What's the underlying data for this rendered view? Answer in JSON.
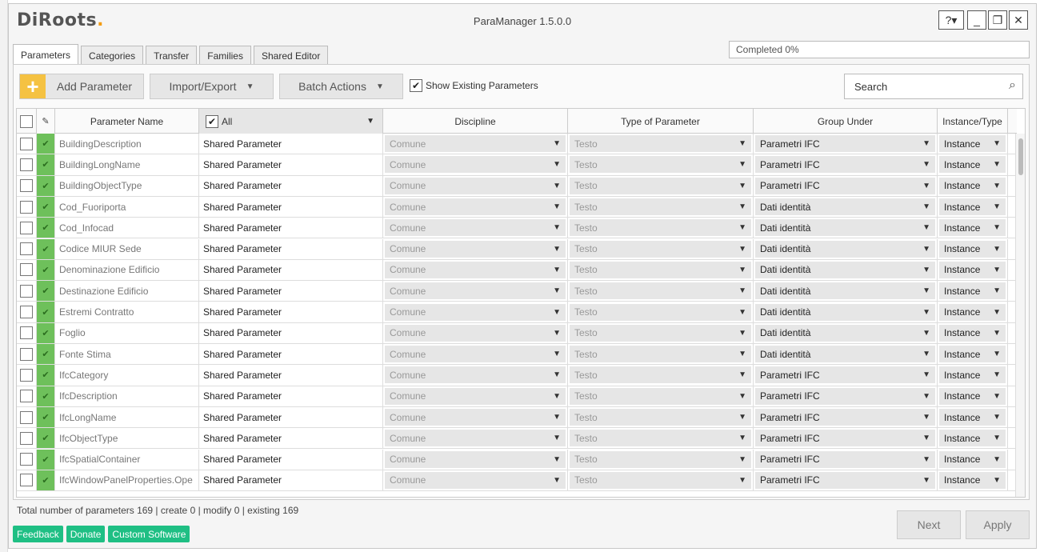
{
  "window": {
    "logo": "DiRoots",
    "logo_dot": ".",
    "title": "ParaManager 1.5.0.0",
    "help_label": "?▾",
    "min_label": "_",
    "max_label": "❐",
    "close_label": "✕"
  },
  "tabs": [
    {
      "label": "Parameters",
      "active": true
    },
    {
      "label": "Categories"
    },
    {
      "label": "Transfer"
    },
    {
      "label": "Families"
    },
    {
      "label": "Shared Editor"
    }
  ],
  "progress": {
    "text": "Completed 0%"
  },
  "toolbar": {
    "add_label": "Add Parameter",
    "import_export_label": "Import/Export",
    "batch_actions_label": "Batch Actions",
    "show_existing_label": "Show Existing Parameters",
    "show_existing_checked": true,
    "search_placeholder": "Search"
  },
  "grid": {
    "headers": {
      "name": "Parameter Name",
      "filter_all": "All",
      "discipline": "Discipline",
      "type": "Type of Parameter",
      "group": "Group Under",
      "instance": "Instance/Type"
    },
    "rows": [
      {
        "name": "BuildingDescription",
        "shared": "Shared Parameter",
        "discipline": "Comune",
        "type": "Testo",
        "group": "Parametri IFC",
        "instance": "Instance"
      },
      {
        "name": "BuildingLongName",
        "shared": "Shared Parameter",
        "discipline": "Comune",
        "type": "Testo",
        "group": "Parametri IFC",
        "instance": "Instance"
      },
      {
        "name": "BuildingObjectType",
        "shared": "Shared Parameter",
        "discipline": "Comune",
        "type": "Testo",
        "group": "Parametri IFC",
        "instance": "Instance"
      },
      {
        "name": "Cod_Fuoriporta",
        "shared": "Shared Parameter",
        "discipline": "Comune",
        "type": "Testo",
        "group": "Dati identità",
        "instance": "Instance"
      },
      {
        "name": "Cod_Infocad",
        "shared": "Shared Parameter",
        "discipline": "Comune",
        "type": "Testo",
        "group": "Dati identità",
        "instance": "Instance"
      },
      {
        "name": "Codice MIUR Sede",
        "shared": "Shared Parameter",
        "discipline": "Comune",
        "type": "Testo",
        "group": "Dati identità",
        "instance": "Instance"
      },
      {
        "name": "Denominazione Edificio",
        "shared": "Shared Parameter",
        "discipline": "Comune",
        "type": "Testo",
        "group": "Dati identità",
        "instance": "Instance"
      },
      {
        "name": "Destinazione Edificio",
        "shared": "Shared Parameter",
        "discipline": "Comune",
        "type": "Testo",
        "group": "Dati identità",
        "instance": "Instance"
      },
      {
        "name": "Estremi Contratto",
        "shared": "Shared Parameter",
        "discipline": "Comune",
        "type": "Testo",
        "group": "Dati identità",
        "instance": "Instance"
      },
      {
        "name": "Foglio",
        "shared": "Shared Parameter",
        "discipline": "Comune",
        "type": "Testo",
        "group": "Dati identità",
        "instance": "Instance"
      },
      {
        "name": "Fonte Stima",
        "shared": "Shared Parameter",
        "discipline": "Comune",
        "type": "Testo",
        "group": "Dati identità",
        "instance": "Instance"
      },
      {
        "name": "IfcCategory",
        "shared": "Shared Parameter",
        "discipline": "Comune",
        "type": "Testo",
        "group": "Parametri IFC",
        "instance": "Instance"
      },
      {
        "name": "IfcDescription",
        "shared": "Shared Parameter",
        "discipline": "Comune",
        "type": "Testo",
        "group": "Parametri IFC",
        "instance": "Instance"
      },
      {
        "name": "IfcLongName",
        "shared": "Shared Parameter",
        "discipline": "Comune",
        "type": "Testo",
        "group": "Parametri IFC",
        "instance": "Instance"
      },
      {
        "name": "IfcObjectType",
        "shared": "Shared Parameter",
        "discipline": "Comune",
        "type": "Testo",
        "group": "Parametri IFC",
        "instance": "Instance"
      },
      {
        "name": "IfcSpatialContainer",
        "shared": "Shared Parameter",
        "discipline": "Comune",
        "type": "Testo",
        "group": "Parametri IFC",
        "instance": "Instance"
      },
      {
        "name": "IfcWindowPanelProperties.Ope",
        "shared": "Shared Parameter",
        "discipline": "Comune",
        "type": "Testo",
        "group": "Parametri IFC",
        "instance": "Instance"
      }
    ]
  },
  "footer": {
    "status": "Total number of parameters 169 | create 0 | modify 0 | existing 169",
    "feedback": "Feedback",
    "donate": "Donate",
    "custom_software": "Custom Software",
    "next": "Next",
    "apply": "Apply"
  },
  "colors": {
    "accent_green": "#1fbf84",
    "row_marker_green": "#6ec05b",
    "add_button_yellow": "#f5c242"
  }
}
